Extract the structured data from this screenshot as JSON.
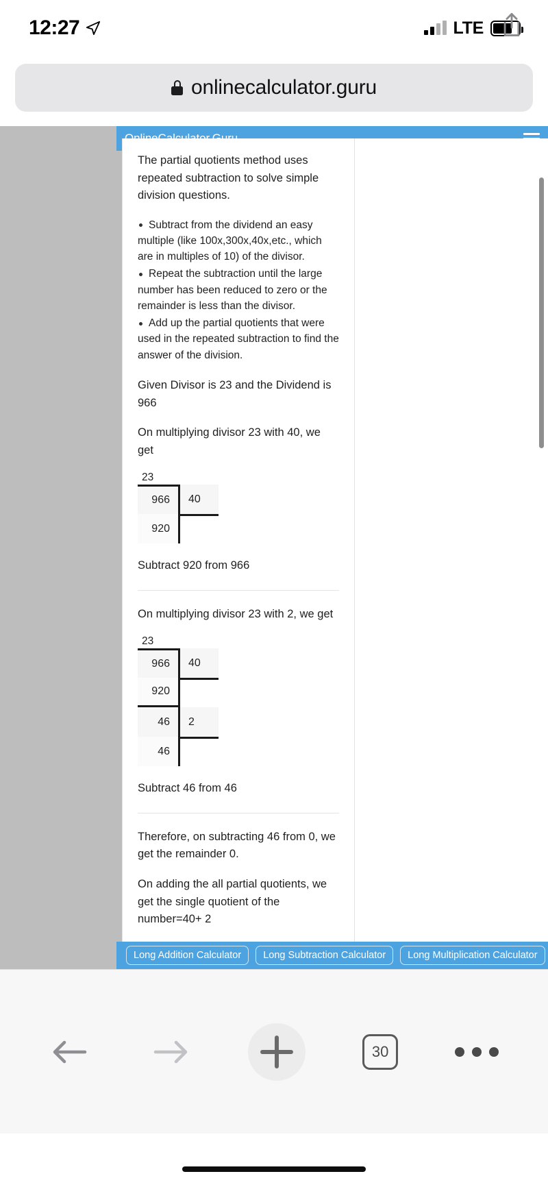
{
  "status_bar": {
    "time": "12:27",
    "location_icon": "location-arrow-icon",
    "network_label": "LTE",
    "signal_icon": "signal-bars-icon",
    "battery_icon": "battery-icon"
  },
  "browser": {
    "url": "onlinecalculator.guru",
    "lock_icon": "lock-icon",
    "share_icon": "share-icon",
    "toolbar": {
      "back_label": "back-arrow-icon",
      "forward_label": "forward-arrow-icon",
      "new_tab_label": "plus-icon",
      "tab_count": "30",
      "more_label": "more-dots-icon"
    }
  },
  "site": {
    "brand": "OnlineCalculator.Guru",
    "menu_icon": "hamburger-menu-icon"
  },
  "article": {
    "intro": "The partial quotients method uses repeated subtraction to solve simple division questions.",
    "rules": [
      "Subtract from the dividend an easy multiple (like 100x,300x,40x,etc., which are in multiples of 10) of the divisor.",
      "Repeat the subtraction until the large number has been reduced to zero or the remainder is less than the divisor.",
      "Add up the partial quotients that were used in the repeated subtraction to find the answer of the division."
    ],
    "given": "Given Divisor is 23 and the Dividend is 966",
    "step1_text": "On multiplying divisor 23 with 40, we get",
    "step1_subtract": "Subtract 920 from 966",
    "step2_text": "On multiplying divisor 23 with 2, we get",
    "step2_subtract": "Subtract 46 from 46",
    "conclusion": "Therefore, on subtracting 46 from 0, we get the remainder 0.",
    "final": "On adding the all partial quotients, we get the single quotient of the number=40+ 2"
  },
  "division": {
    "divisor": "23",
    "step1": {
      "dividend": "966",
      "partial_quotient": "40",
      "product": "920"
    },
    "step2": {
      "dividend": "966",
      "partial_quotient": "40",
      "product": "920",
      "remainder": "46",
      "partial_quotient2": "2",
      "product2": "46"
    }
  },
  "footer_links": [
    "Long Addition Calculator",
    "Long Subtraction Calculator",
    "Long Multiplication Calculator"
  ],
  "colors": {
    "brand_blue": "#4da2e0",
    "page_bg": "#bdbdbd",
    "text": "#1f1f1f"
  }
}
